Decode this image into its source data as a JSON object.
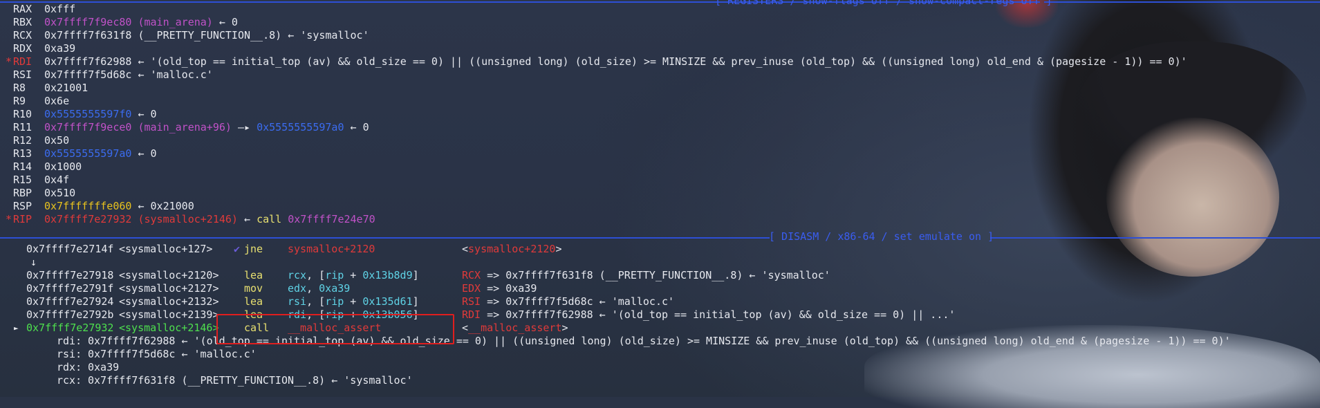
{
  "headers": {
    "registers": "[ REGISTERS / show-flags off / show-compact-regs off ]",
    "disasm": "[ DISASM / x86-64 / set emulate on ]"
  },
  "registers": [
    {
      "name": "RAX",
      "changed": false,
      "parts": [
        {
          "t": "0xfff",
          "c": "white"
        }
      ]
    },
    {
      "name": "RBX",
      "changed": false,
      "parts": [
        {
          "t": "0x7ffff7f9ec80 (main_arena)",
          "c": "purple"
        },
        {
          "t": " ← 0",
          "c": "white"
        }
      ]
    },
    {
      "name": "RCX",
      "changed": false,
      "parts": [
        {
          "t": "0x7ffff7f631f8 (__PRETTY_FUNCTION__.8) ← 'sysmalloc'",
          "c": "white"
        }
      ]
    },
    {
      "name": "RDX",
      "changed": false,
      "parts": [
        {
          "t": "0xa39",
          "c": "white"
        }
      ]
    },
    {
      "name": "RDI",
      "changed": true,
      "parts": [
        {
          "t": "0x7ffff7f62988 ← '(old_top == initial_top (av) && old_size == 0) || ((unsigned long) (old_size) >= MINSIZE && prev_inuse (old_top) && ((unsigned long) old_end & (pagesize - 1)) == 0)'",
          "c": "white"
        }
      ]
    },
    {
      "name": "RSI",
      "changed": false,
      "parts": [
        {
          "t": "0x7ffff7f5d68c ← 'malloc.c'",
          "c": "white"
        }
      ]
    },
    {
      "name": "R8",
      "changed": false,
      "parts": [
        {
          "t": "0x21001",
          "c": "white"
        }
      ]
    },
    {
      "name": "R9",
      "changed": false,
      "parts": [
        {
          "t": "0x6e",
          "c": "white"
        }
      ]
    },
    {
      "name": "R10",
      "changed": false,
      "parts": [
        {
          "t": "0x5555555597f0",
          "c": "blue"
        },
        {
          "t": " ← 0",
          "c": "white"
        }
      ]
    },
    {
      "name": "R11",
      "changed": false,
      "parts": [
        {
          "t": "0x7ffff7f9ece0 (main_arena+96)",
          "c": "purple"
        },
        {
          "t": " —▸ ",
          "c": "white"
        },
        {
          "t": "0x5555555597a0",
          "c": "blue"
        },
        {
          "t": " ← 0",
          "c": "white"
        }
      ]
    },
    {
      "name": "R12",
      "changed": false,
      "parts": [
        {
          "t": "0x50",
          "c": "white"
        }
      ]
    },
    {
      "name": "R13",
      "changed": false,
      "parts": [
        {
          "t": "0x5555555597a0",
          "c": "blue"
        },
        {
          "t": " ← 0",
          "c": "white"
        }
      ]
    },
    {
      "name": "R14",
      "changed": false,
      "parts": [
        {
          "t": "0x1000",
          "c": "white"
        }
      ]
    },
    {
      "name": "R15",
      "changed": false,
      "parts": [
        {
          "t": "0x4f",
          "c": "white"
        }
      ]
    },
    {
      "name": "RBP",
      "changed": false,
      "parts": [
        {
          "t": "0x510",
          "c": "white"
        }
      ]
    },
    {
      "name": "RSP",
      "changed": false,
      "parts": [
        {
          "t": "0x7fffffffe060",
          "c": "yellow"
        },
        {
          "t": " ← 0x21000",
          "c": "white"
        }
      ]
    },
    {
      "name": "RIP",
      "changed": true,
      "parts": [
        {
          "t": "0x7ffff7e27932 (sysmalloc+2146)",
          "c": "red"
        },
        {
          "t": " ← ",
          "c": "white"
        },
        {
          "t": "call",
          "c": "lyellow"
        },
        {
          "t": " 0x7ffff7e24e70",
          "c": "purple"
        }
      ]
    }
  ],
  "disasm": [
    {
      "addr": "0x7ffff7e2714f",
      "sym": "<sysmalloc+127>",
      "mark": "✔",
      "mnem": "jne",
      "ops": [
        {
          "t": "sysmalloc+2120",
          "c": "red"
        }
      ],
      "comment": [
        {
          "t": "<",
          "c": "white"
        },
        {
          "t": "sysmalloc+2120",
          "c": "red"
        },
        {
          "t": ">",
          "c": "white"
        }
      ],
      "current": false
    },
    {
      "arrow": "↓"
    },
    {
      "addr": "0x7ffff7e27918",
      "sym": "<sysmalloc+2120>",
      "mnem": "lea",
      "ops": [
        {
          "t": "rcx",
          "c": "cyan"
        },
        {
          "t": ", [",
          "c": "white"
        },
        {
          "t": "rip",
          "c": "cyan"
        },
        {
          "t": " + ",
          "c": "white"
        },
        {
          "t": "0x13b8d9",
          "c": "cyan"
        },
        {
          "t": "]",
          "c": "white"
        }
      ],
      "comment": [
        {
          "t": "RCX",
          "c": "red"
        },
        {
          "t": " => 0x7ffff7f631f8 (__PRETTY_FUNCTION__.8) ← 'sysmalloc'",
          "c": "white"
        }
      ],
      "current": false
    },
    {
      "addr": "0x7ffff7e2791f",
      "sym": "<sysmalloc+2127>",
      "mnem": "mov",
      "ops": [
        {
          "t": "edx",
          "c": "cyan"
        },
        {
          "t": ", ",
          "c": "white"
        },
        {
          "t": "0xa39",
          "c": "cyan"
        }
      ],
      "comment": [
        {
          "t": "EDX",
          "c": "red"
        },
        {
          "t": " => 0xa39",
          "c": "white"
        }
      ],
      "current": false
    },
    {
      "addr": "0x7ffff7e27924",
      "sym": "<sysmalloc+2132>",
      "mnem": "lea",
      "ops": [
        {
          "t": "rsi",
          "c": "cyan"
        },
        {
          "t": ", [",
          "c": "white"
        },
        {
          "t": "rip",
          "c": "cyan"
        },
        {
          "t": " + ",
          "c": "white"
        },
        {
          "t": "0x135d61",
          "c": "cyan"
        },
        {
          "t": "]",
          "c": "white"
        }
      ],
      "comment": [
        {
          "t": "RSI",
          "c": "red"
        },
        {
          "t": " => 0x7ffff7f5d68c ← 'malloc.c'",
          "c": "white"
        }
      ],
      "current": false
    },
    {
      "addr": "0x7ffff7e2792b",
      "sym": "<sysmalloc+2139>",
      "mnem": "lea",
      "ops": [
        {
          "t": "rdi",
          "c": "cyan"
        },
        {
          "t": ", [",
          "c": "white"
        },
        {
          "t": "rip",
          "c": "cyan"
        },
        {
          "t": " + ",
          "c": "white"
        },
        {
          "t": "0x13b056",
          "c": "cyan"
        },
        {
          "t": "]",
          "c": "white"
        }
      ],
      "comment": [
        {
          "t": "RDI",
          "c": "red"
        },
        {
          "t": " => 0x7ffff7f62988 ← '(old_top == initial_top (av) && old_size == 0) || ...'",
          "c": "white"
        }
      ],
      "current": false
    },
    {
      "addr": "0x7ffff7e27932",
      "sym": "<sysmalloc+2146>",
      "mnem": "call",
      "ops": [
        {
          "t": "__malloc_assert",
          "c": "red"
        }
      ],
      "comment": [
        {
          "t": "<",
          "c": "white"
        },
        {
          "t": "__malloc_assert",
          "c": "red"
        },
        {
          "t": ">",
          "c": "white"
        }
      ],
      "current": true
    }
  ],
  "call_args": [
    {
      "name": "rdi",
      "value": "0x7ffff7f62988 ← '(old_top == initial_top (av) && old_size == 0) || ((unsigned long) (old_size) >= MINSIZE && prev_inuse (old_top) && ((unsigned long) old_end & (pagesize - 1)) == 0)'"
    },
    {
      "name": "rsi",
      "value": "0x7ffff7f5d68c ← 'malloc.c'"
    },
    {
      "name": "rdx",
      "value": "0xa39"
    },
    {
      "name": "rcx",
      "value": "0x7ffff7f631f8 (__PRETTY_FUNCTION__.8) ← 'sysmalloc'"
    }
  ],
  "colors": {
    "header": "#3a5df0",
    "purple": "#c152c8",
    "blue": "#3b6cf0",
    "yellow": "#e8c21e",
    "red": "#e03a3a",
    "green": "#4ee04e",
    "mnemonic": "#e8e070",
    "operand": "#5fd3e6",
    "highlight_box": "#e01e1e"
  }
}
